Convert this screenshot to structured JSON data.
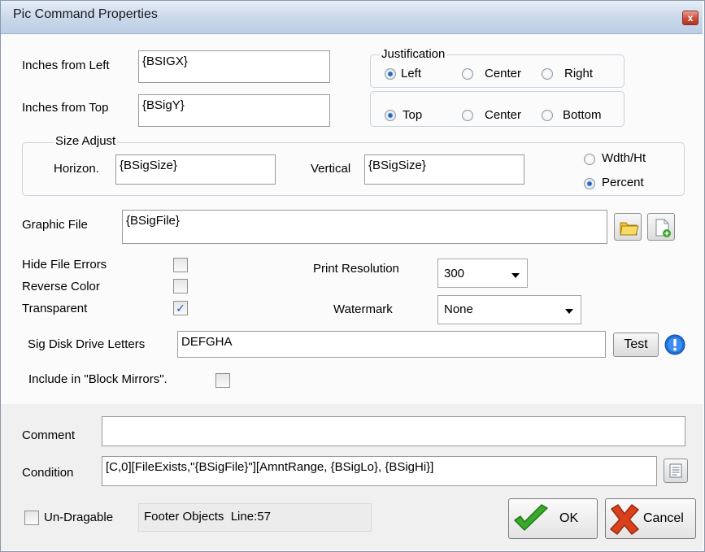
{
  "window": {
    "title": "Pic Command Properties",
    "close_label": "x"
  },
  "position": {
    "left_label": "Inches from Left",
    "left_value": "{BSIGX}",
    "top_label": "Inches from Top",
    "top_value": "{BSigY}"
  },
  "justification": {
    "legend": "Justification",
    "horizontal": [
      "Left",
      "Center",
      "Right"
    ],
    "horizontal_selected": "Left",
    "vertical": [
      "Top",
      "Center",
      "Bottom"
    ],
    "vertical_selected": "Top"
  },
  "size_adjust": {
    "legend": "Size Adjust",
    "horizon_label": "Horizon.",
    "horizon_value": "{BSigSize}",
    "vertical_label": "Vertical",
    "vertical_value": "{BSigSize}",
    "mode_options": [
      "Wdth/Ht",
      "Percent"
    ],
    "mode_selected": "Percent"
  },
  "graphic_file": {
    "label": "Graphic File",
    "value": "{BSigFile}"
  },
  "options": {
    "hide_file_errors": {
      "label": "Hide File Errors",
      "checked": false
    },
    "reverse_color": {
      "label": "Reverse Color",
      "checked": false
    },
    "transparent": {
      "label": "Transparent",
      "checked": true
    },
    "print_resolution": {
      "label": "Print Resolution",
      "value": "300"
    },
    "watermark": {
      "label": "Watermark",
      "value": "None"
    }
  },
  "sig_disk": {
    "label": "Sig Disk Drive Letters",
    "value": "DEFGHA",
    "test_label": "Test"
  },
  "block_mirrors": {
    "label": "Include in \"Block Mirrors\".",
    "checked": false
  },
  "comment": {
    "label": "Comment",
    "value": ""
  },
  "condition": {
    "label": "Condition",
    "value": "[C,0][FileExists,\"{BSigFile}\"][AmntRange, {BSigLo}, {BSigHi}]"
  },
  "footer": {
    "undragable_label": "Un-Dragable",
    "undragable_checked": false,
    "status_text": "Footer Objects  Line:57",
    "ok_label": "OK",
    "cancel_label": "Cancel"
  },
  "colors": {
    "title_bar": "#c9d8ea",
    "ok_check": "#3aa82a",
    "cancel_x": "#d9401c",
    "info_icon": "#1f6fd6",
    "folder_icon": "#f2c232"
  }
}
